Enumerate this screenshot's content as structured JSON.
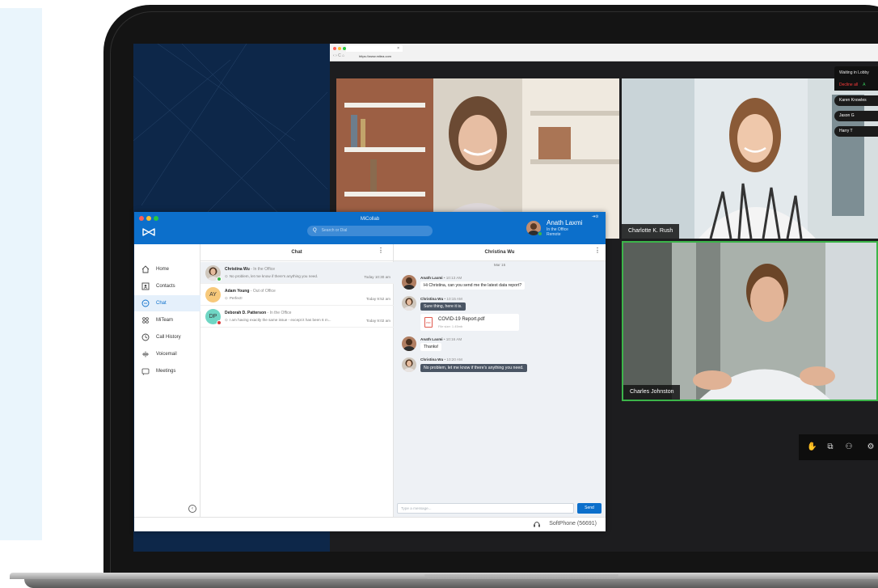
{
  "browser": {
    "tab_label": "×",
    "nav_glyphs": "‹ › C ⌂",
    "url": "https://www.mitea.com"
  },
  "meeting": {
    "participants": [
      {
        "name": ""
      },
      {
        "name": "Charlotte K. Rush"
      },
      {
        "name": "Charles Johnston"
      }
    ],
    "lobby": {
      "title": "Waiting in Lobby",
      "decline_all": "Decline all",
      "admit_all": "A",
      "waiting": [
        "Karen Knowles",
        "Jason G",
        "Harry T"
      ]
    },
    "controls": [
      "hand-icon",
      "share-screen-icon",
      "participants-icon",
      "settings-icon"
    ]
  },
  "app": {
    "title": "MiCollab",
    "search_placeholder": "Search or Dial",
    "search_icon": "Q",
    "logout_glyph": "⇥⊙",
    "user": {
      "name": "Anath Laxmi",
      "status1": "In the Office",
      "status2": "Remote"
    },
    "nav": [
      {
        "label": "Home",
        "icon": "home-icon"
      },
      {
        "label": "Contacts",
        "icon": "contacts-icon"
      },
      {
        "label": "Chat",
        "icon": "chat-icon",
        "active": true
      },
      {
        "label": "MiTeam",
        "icon": "team-icon"
      },
      {
        "label": "Call History",
        "icon": "clock-icon"
      },
      {
        "label": "Voicemail",
        "icon": "voicemail-icon"
      },
      {
        "label": "Meetings",
        "icon": "meetings-icon"
      }
    ],
    "collapse_glyph": "‹",
    "chat_title": "Chat",
    "conversations": [
      {
        "name": "Christina Wu",
        "status": " - In the Office",
        "preview": "No problem, let me know if there's anything you need.",
        "time": "Today 10:30 am",
        "avatar": "",
        "status_color": "#3cb54a"
      },
      {
        "name": "Adam Young",
        "status": " - Out of Office",
        "preview": "Perfect!",
        "time": "Today 9:52 am",
        "avatar": "AY",
        "status_color": ""
      },
      {
        "name": "Deborah D. Patterson",
        "status": " - In the Office",
        "preview": "I am having exactly the same issue - except it has been 6 m...",
        "time": "Today 9:02 am",
        "avatar": "DP",
        "status_color": "#d93a3a"
      }
    ],
    "conversation_title": "Christina Wu",
    "date_separator": "Mar 15",
    "messages": [
      {
        "author": "Anath Laxmi",
        "time": " • 10:13 AM",
        "text": "Hi Christina, can you send me the latest data report?"
      },
      {
        "author": "Christina Wu",
        "time": " • 10:15 AM",
        "text": "Sure thing, here it is."
      },
      {
        "author": "Anath Laxmi",
        "time": " • 10:16 AM",
        "text": "Thanks!"
      },
      {
        "author": "Christina Wu",
        "time": " • 10:20 AM",
        "text": "No problem, let me know if there's anything you need."
      }
    ],
    "file": {
      "name": "COVID-19 Report.pdf",
      "size": "File size: 1.45mb",
      "badge": "PDF"
    },
    "message_placeholder": "Type a message...",
    "send_label": "Send",
    "softphone": "SoftPhone (56691)",
    "kebab_glyph": "⋮"
  },
  "colors": {
    "app_blue": "#0c6fcb",
    "bg_navy": "#0d2749",
    "active_speaker": "#3cb54a"
  }
}
